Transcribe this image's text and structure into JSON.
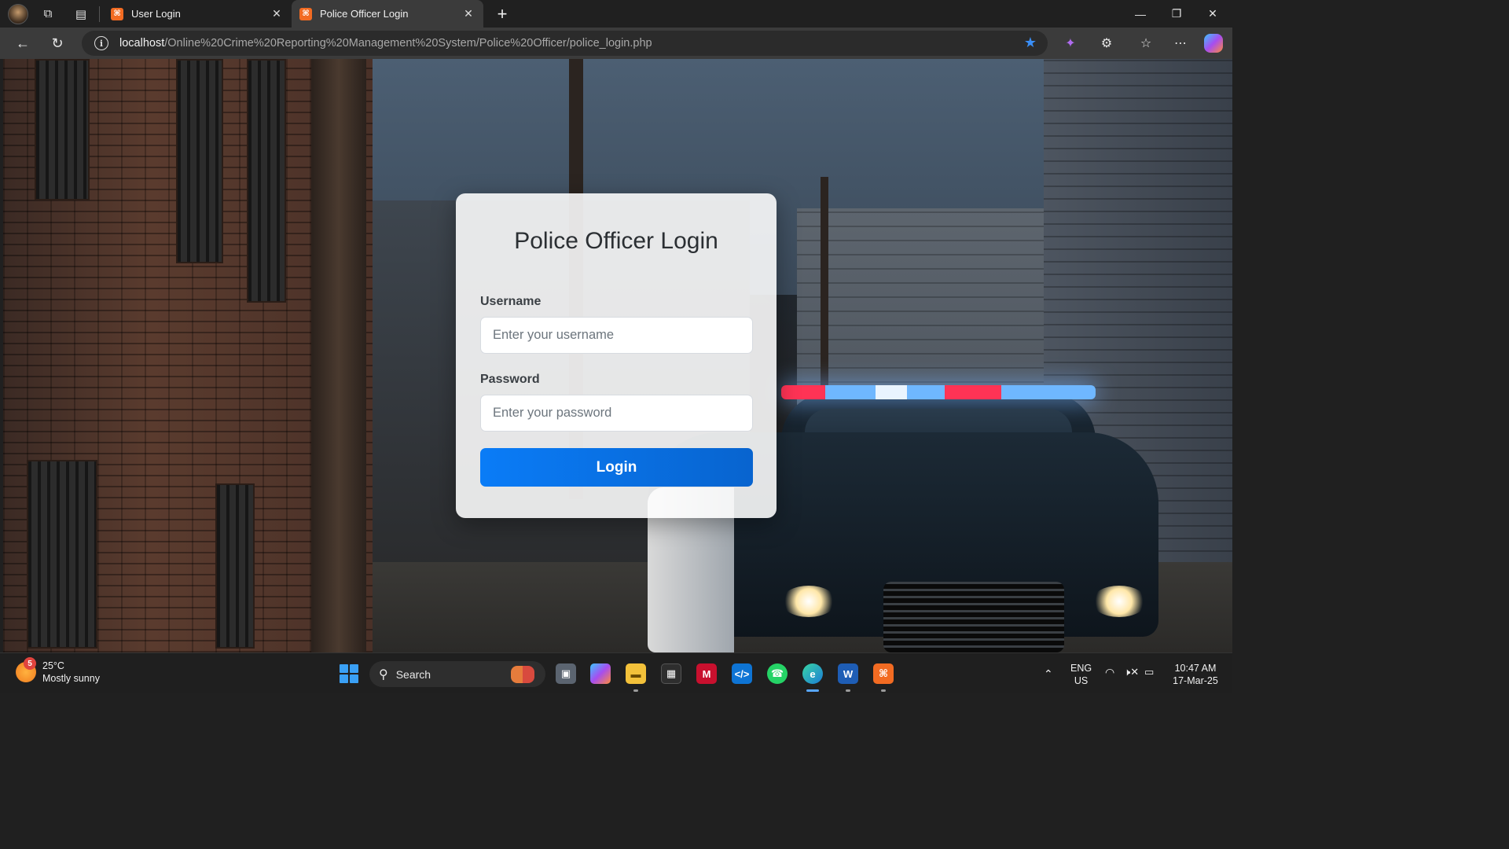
{
  "browser": {
    "tabs": [
      {
        "title": "User Login",
        "favicon": "xampp-icon",
        "active": false
      },
      {
        "title": "Police Officer Login",
        "favicon": "xampp-icon",
        "active": true
      }
    ],
    "url_host": "localhost",
    "url_path": "/Online%20Crime%20Reporting%20Management%20System/Police%20Officer/police_login.php"
  },
  "login": {
    "title": "Police Officer Login",
    "username_label": "Username",
    "username_placeholder": "Enter your username",
    "username_value": "",
    "password_label": "Password",
    "password_placeholder": "Enter your password",
    "password_value": "",
    "button_label": "Login"
  },
  "taskbar": {
    "weather_badge": "5",
    "weather_temp": "25°C",
    "weather_desc": "Mostly sunny",
    "search_label": "Search",
    "lang_top": "ENG",
    "lang_bottom": "US",
    "time": "10:47 AM",
    "date": "17-Mar-25"
  },
  "colors": {
    "accent": "#0a7cf7",
    "xampp": "#f26b22",
    "taskbar_bg": "#1f1f1f"
  }
}
